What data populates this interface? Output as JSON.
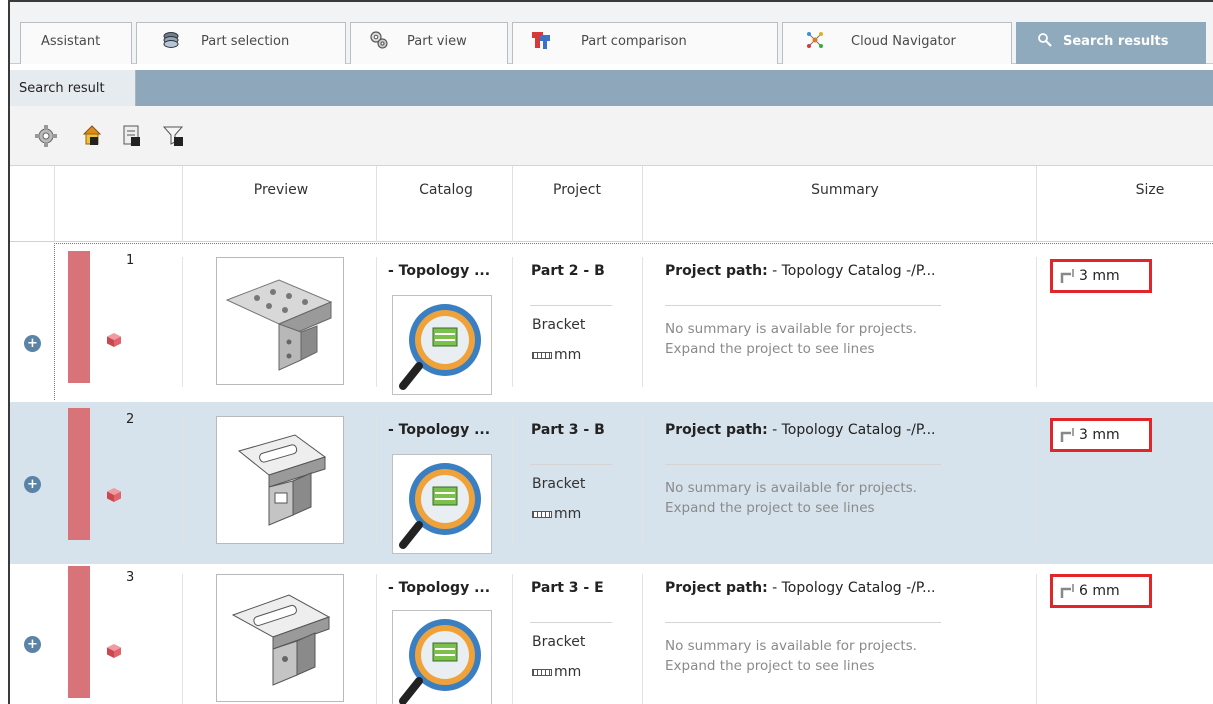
{
  "tabs": [
    {
      "label": "Assistant",
      "icon": "none"
    },
    {
      "label": "Part selection",
      "icon": "parts-stack-icon"
    },
    {
      "label": "Part view",
      "icon": "gears-icon"
    },
    {
      "label": "Part comparison",
      "icon": "compare-icon"
    },
    {
      "label": "Cloud Navigator",
      "icon": "network-icon"
    },
    {
      "label": "Search results",
      "icon": "search-icon",
      "active": true
    }
  ],
  "subtab": {
    "label": "Search result"
  },
  "toolbar": {
    "icons": [
      "settings-icon",
      "home-folder-icon",
      "export-icon",
      "filter-icon"
    ]
  },
  "columns": {
    "preview": "Preview",
    "catalog": "Catalog",
    "project": "Project",
    "summary": "Summary",
    "size": "Size"
  },
  "rows": [
    {
      "num": "1",
      "catalog": "- Topology ...",
      "project_title": "Part 2 - B",
      "project_type": "Bracket",
      "project_unit": "mm",
      "summary_label": "Project path:",
      "summary_value": " - Topology Catalog -/P...",
      "summary_line1": "No summary is available for projects.",
      "summary_line2": "Expand the project to see lines",
      "size": "3 mm",
      "selected": false
    },
    {
      "num": "2",
      "catalog": "- Topology ...",
      "project_title": "Part 3 - B",
      "project_type": "Bracket",
      "project_unit": "mm",
      "summary_label": "Project path:",
      "summary_value": " - Topology Catalog -/P...",
      "summary_line1": "No summary is available for projects.",
      "summary_line2": "Expand the project to see lines",
      "size": "3 mm",
      "selected": true
    },
    {
      "num": "3",
      "catalog": "- Topology ...",
      "project_title": "Part 3 - E",
      "project_type": "Bracket",
      "project_unit": "mm",
      "summary_label": "Project path:",
      "summary_value": " - Topology Catalog -/P...",
      "summary_line1": "No summary is available for projects.",
      "summary_line2": "Expand the project to see lines",
      "size": "6 mm",
      "selected": false
    }
  ],
  "colors": {
    "tab_active": "#8fa9bd",
    "row_marker": "#d9737a",
    "highlight_border": "#e0262b",
    "selected_row": "#d7e3ec"
  }
}
